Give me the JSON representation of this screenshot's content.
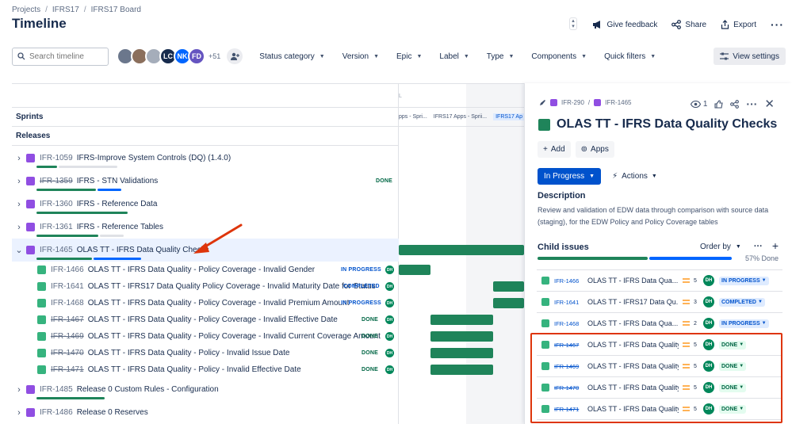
{
  "breadcrumbs": [
    "Projects",
    "IFRS17",
    "IFRS17 Board"
  ],
  "page_title": "Timeline",
  "header_actions": {
    "feedback": "Give feedback",
    "share": "Share",
    "export": "Export"
  },
  "search": {
    "placeholder": "Search timeline"
  },
  "avatars": [
    {
      "initials": "",
      "color": "#6b778c"
    },
    {
      "initials": "",
      "color": "#8b6f5c"
    },
    {
      "initials": "",
      "color": "#a5adba"
    },
    {
      "initials": "LC",
      "color": "#172b4d"
    },
    {
      "initials": "NK",
      "color": "#0065ff"
    },
    {
      "initials": "FD",
      "color": "#6554c0"
    }
  ],
  "avatars_more": "+51",
  "filters": [
    "Status category",
    "Version",
    "Epic",
    "Label",
    "Type",
    "Components",
    "Quick filters"
  ],
  "view_settings": "View settings",
  "sections": {
    "sprints": "Sprints",
    "releases": "Releases"
  },
  "sprint_labels": [
    "pps - Spri...",
    "IFRS17 Apps - Sprii...",
    "IFRS17 Ap"
  ],
  "chart_tick": "L",
  "rows": [
    {
      "type": "parent",
      "key": "IFR-1059",
      "title": "IFRS-Improve System Controls (DQ) (1.4.0)",
      "strike": false,
      "status": ""
    },
    {
      "type": "parent",
      "key": "IFR-1359",
      "title": "IFRS - STN Validations",
      "strike": true,
      "status": "DONE"
    },
    {
      "type": "parent",
      "key": "IFR-1360",
      "title": "IFRS - Reference Data",
      "strike": false,
      "status": ""
    },
    {
      "type": "parent",
      "key": "IFR-1361",
      "title": "IFRS - Reference Tables",
      "strike": false,
      "status": ""
    },
    {
      "type": "parent",
      "key": "IFR-1465",
      "title": "OLAS TT - IFRS Data Quality Checks",
      "strike": false,
      "status": ""
    },
    {
      "type": "child",
      "key": "IFR-1466",
      "title": "OLAS TT - IFRS Data Quality - Policy Coverage - Invalid Gender",
      "strike": false,
      "status": "IN PROGRESS",
      "avatar": "DH"
    },
    {
      "type": "child",
      "key": "IFR-1641",
      "title": "OLAS TT - IFRS17 Data Quality Policy Coverage - Invalid Maturity Date for Status",
      "strike": false,
      "status": "COMPLETED",
      "avatar": "DH"
    },
    {
      "type": "child",
      "key": "IFR-1468",
      "title": "OLAS TT - IFRS Data Quality - Policy Coverage - Invalid Premium Amount",
      "strike": false,
      "status": "IN PROGRESS",
      "avatar": "DH"
    },
    {
      "type": "child",
      "key": "IFR-1467",
      "title": "OLAS TT - IFRS Data Quality - Policy Coverage - Invalid Effective Date",
      "strike": true,
      "status": "DONE",
      "avatar": "DH"
    },
    {
      "type": "child",
      "key": "IFR-1469",
      "title": "OLAS TT - IFRS Data Quality - Policy Coverage - Invalid Current Coverage Amount",
      "strike": true,
      "status": "DONE",
      "avatar": "DH"
    },
    {
      "type": "child",
      "key": "IFR-1470",
      "title": "OLAS TT - IFRS Data Quality - Policy - Invalid Issue Date",
      "strike": true,
      "status": "DONE",
      "avatar": "DH"
    },
    {
      "type": "child",
      "key": "IFR-1471",
      "title": "OLAS TT - IFRS Data Quality - Policy - Invalid Effective Date",
      "strike": true,
      "status": "DONE",
      "avatar": "DH"
    },
    {
      "type": "parent",
      "key": "IFR-1485",
      "title": "Release 0 Custom Rules - Configuration",
      "strike": false,
      "status": ""
    },
    {
      "type": "parent",
      "key": "IFR-1486",
      "title": "Release 0 Reserves",
      "strike": false,
      "status": ""
    }
  ],
  "panel": {
    "crumbs": [
      "IFR-290",
      "IFR-1465"
    ],
    "watchers": "1",
    "title": "OLAS TT - IFRS Data Quality Checks",
    "add_label": "Add",
    "apps_label": "Apps",
    "status_button": "In Progress",
    "actions_label": "Actions",
    "description_heading": "Description",
    "description": "Review and validation of EDW data through comparison with source data (staging), for the EDW Policy and Policy Coverage tables",
    "child_heading": "Child issues",
    "order_by": "Order by",
    "progress_text": "57% Done",
    "children": [
      {
        "key": "IFR-1466",
        "summary": "OLAS TT - IFRS Data Qua...",
        "points": "5",
        "avatar": "DH",
        "status": "IN PROGRESS",
        "strike": false
      },
      {
        "key": "IFR-1641",
        "summary": "OLAS TT - IFRS17 Data Qu...",
        "points": "3",
        "avatar": "DH",
        "status": "COMPLETED",
        "strike": false
      },
      {
        "key": "IFR-1468",
        "summary": "OLAS TT - IFRS Data Qua...",
        "points": "2",
        "avatar": "DH",
        "status": "IN PROGRESS",
        "strike": false
      },
      {
        "key": "IFR-1467",
        "summary": "OLAS TT - IFRS Data Quality - P...",
        "points": "5",
        "avatar": "DH",
        "status": "DONE",
        "strike": true
      },
      {
        "key": "IFR-1469",
        "summary": "OLAS TT - IFRS Data Quality - P...",
        "points": "5",
        "avatar": "DH",
        "status": "DONE",
        "strike": true
      },
      {
        "key": "IFR-1470",
        "summary": "OLAS TT - IFRS Data Quality - P...",
        "points": "5",
        "avatar": "DH",
        "status": "DONE",
        "strike": true
      },
      {
        "key": "IFR-1471",
        "summary": "OLAS TT - IFRS Data Quality - P...",
        "points": "5",
        "avatar": "DH",
        "status": "DONE",
        "strike": true
      }
    ]
  },
  "colors": {
    "done": "#1f845a",
    "in_progress": "#0052cc",
    "epic": "#904ee2",
    "story": "#36b37e",
    "annotation": "#de350b"
  }
}
